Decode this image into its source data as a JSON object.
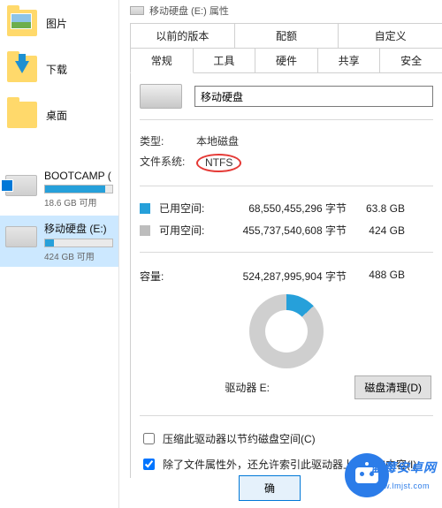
{
  "left_panel": {
    "items": [
      {
        "label": "图片"
      },
      {
        "label": "下载"
      },
      {
        "label": "桌面"
      }
    ],
    "drives": [
      {
        "name": "BOOTCAMP (",
        "free_text": "18.6 GB 可用",
        "fill_pct": 90
      },
      {
        "name": "移动硬盘 (E:)",
        "free_text": "424 GB 可用",
        "fill_pct": 13
      }
    ]
  },
  "window_title": "移动硬盘 (E:) 属性",
  "tabs_top": [
    "以前的版本",
    "配额",
    "自定义"
  ],
  "tabs_bottom": [
    "常规",
    "工具",
    "硬件",
    "共享",
    "安全"
  ],
  "name_field_value": "移动硬盘",
  "type_label": "类型:",
  "type_value": "本地磁盘",
  "fs_label": "文件系统:",
  "fs_value": "NTFS",
  "used_label": "已用空间:",
  "used_bytes": "68,550,455,296 字节",
  "used_human": "63.8 GB",
  "free_label": "可用空间:",
  "free_bytes": "455,737,540,608 字节",
  "free_human": "424 GB",
  "capacity_label": "容量:",
  "capacity_bytes": "524,287,995,904 字节",
  "capacity_human": "488 GB",
  "drive_letter_text": "驱动器 E:",
  "cleanup_button": "磁盘清理(D)",
  "compress_checkbox_label": "压缩此驱动器以节约磁盘空间(C)",
  "index_checkbox_label": "除了文件属性外，还允许索引此驱动器上文件的内容(I)",
  "ok_button": "确",
  "watermark": {
    "line1": "蓝莓安卓网",
    "line2": "www.lmjst.com"
  },
  "chart_data": {
    "type": "pie",
    "title": "驱动器 E:",
    "series": [
      {
        "name": "已用空间",
        "value_bytes": 68550455296,
        "value_gb": 63.8,
        "color": "#26A0DA"
      },
      {
        "name": "可用空间",
        "value_bytes": 455737540608,
        "value_gb": 424,
        "color": "#CFCFCF"
      }
    ],
    "total_bytes": 524287995904,
    "total_gb": 488
  }
}
